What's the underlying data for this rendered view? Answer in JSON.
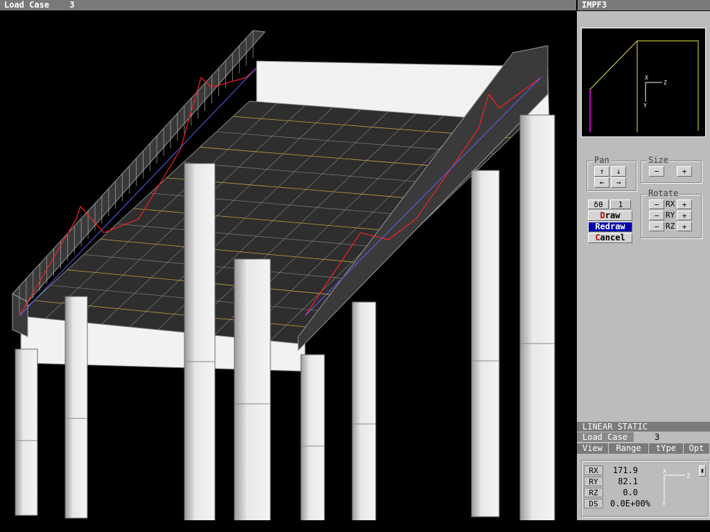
{
  "window": {
    "load_case_label": "Load Case",
    "load_case_value": "3",
    "side_title": "IMPF3"
  },
  "preview": {
    "axis_x": "X",
    "axis_z": "Z",
    "axis_y": "Y"
  },
  "controls": {
    "pan_label": "Pan",
    "size_label": "Size",
    "rotate_label": "Rotate",
    "pan_up": "↑",
    "pan_down": "↓",
    "pan_left": "←",
    "pan_right": "→",
    "size_minus": "−",
    "size_plus": "+",
    "rx": "RX",
    "ry": "RY",
    "rz": "RZ",
    "minus": "−",
    "plus": "+",
    "delta_theta_label": "δθ",
    "delta_theta_value": "1",
    "draw_label_rest": "raw",
    "draw_hot": "D",
    "redraw_label": "Redraw",
    "cancel_hot": "C",
    "cancel_label_rest": "ancel"
  },
  "panel": {
    "analysis_type": "LINEAR STATIC",
    "load_case_label": "Load Case",
    "load_case_value": "3",
    "tabs": [
      "View",
      "Range",
      "tYpe",
      "Opt"
    ]
  },
  "readout": {
    "rx_label": "RX",
    "rx_value": "171.9",
    "ry_label": "RY",
    "ry_value": "82.1",
    "rz_label": "RZ",
    "rz_value": "0.0",
    "ds_label": "DS",
    "ds_value": "0.0E+00%",
    "axis_x": "X",
    "axis_z": "Z",
    "axis_y": "Y"
  },
  "colors": {
    "title_bar": "#7a7a7a",
    "panel_bg": "#bcbcbc",
    "redraw_bg": "#0000a8",
    "moment_diagram": "#ff0000",
    "slab_rebar": "#c8a040",
    "column": "#f0f0f0"
  }
}
